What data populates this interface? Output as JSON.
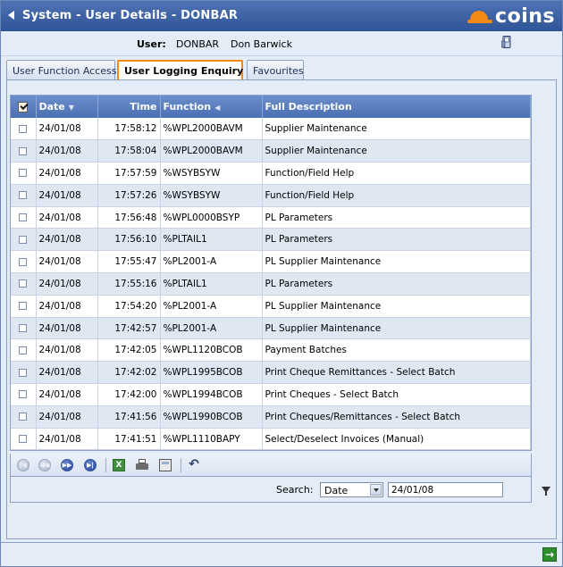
{
  "window": {
    "title": "System - User Details - DONBAR",
    "logo_text": "coins",
    "accent_color": "#f08a14",
    "titlebar_color": "#2f5497"
  },
  "user": {
    "label": "User:",
    "code": "DONBAR",
    "name": "Don Barwick"
  },
  "tabs": [
    {
      "label": "User Function Access",
      "active": false
    },
    {
      "label": "User Logging Enquiry",
      "active": true
    },
    {
      "label": "Favourites",
      "active": false
    }
  ],
  "grid": {
    "columns": [
      "Date",
      "Time",
      "Function",
      "Full Description"
    ],
    "rows": [
      {
        "date": "24/01/08",
        "time": "17:58:12",
        "function": "%WPL2000BAVM",
        "description": "Supplier Maintenance"
      },
      {
        "date": "24/01/08",
        "time": "17:58:04",
        "function": "%WPL2000BAVM",
        "description": "Supplier Maintenance"
      },
      {
        "date": "24/01/08",
        "time": "17:57:59",
        "function": "%WSYBSYW",
        "description": "Function/Field Help"
      },
      {
        "date": "24/01/08",
        "time": "17:57:26",
        "function": "%WSYBSYW",
        "description": "Function/Field Help"
      },
      {
        "date": "24/01/08",
        "time": "17:56:48",
        "function": "%WPL0000BSYP",
        "description": "PL Parameters"
      },
      {
        "date": "24/01/08",
        "time": "17:56:10",
        "function": "%PLTAIL1",
        "description": "PL Parameters"
      },
      {
        "date": "24/01/08",
        "time": "17:55:47",
        "function": "%PL2001-A",
        "description": "PL Supplier Maintenance"
      },
      {
        "date": "24/01/08",
        "time": "17:55:16",
        "function": "%PLTAIL1",
        "description": "PL Parameters"
      },
      {
        "date": "24/01/08",
        "time": "17:54:20",
        "function": "%PL2001-A",
        "description": "PL Supplier Maintenance"
      },
      {
        "date": "24/01/08",
        "time": "17:42:57",
        "function": "%PL2001-A",
        "description": "PL Supplier Maintenance"
      },
      {
        "date": "24/01/08",
        "time": "17:42:05",
        "function": "%WPL1120BCOB",
        "description": "Payment Batches"
      },
      {
        "date": "24/01/08",
        "time": "17:42:02",
        "function": "%WPL1995BCOB",
        "description": "Print Cheque Remittances - Select Batch"
      },
      {
        "date": "24/01/08",
        "time": "17:42:00",
        "function": "%WPL1994BCOB",
        "description": "Print Cheques - Select Batch"
      },
      {
        "date": "24/01/08",
        "time": "17:41:56",
        "function": "%WPL1990BCOB",
        "description": "Print Cheques/Remittances - Select Batch"
      },
      {
        "date": "24/01/08",
        "time": "17:41:51",
        "function": "%WPL1110BAPY",
        "description": "Select/Deselect Invoices (Manual)"
      }
    ]
  },
  "search": {
    "label": "Search:",
    "field_selected": "Date",
    "value": "24/01/08"
  }
}
